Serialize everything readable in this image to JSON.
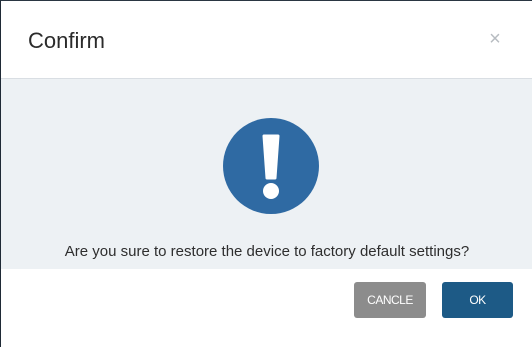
{
  "dialog": {
    "title": "Confirm",
    "close_glyph": "×",
    "icon": "exclamation-icon",
    "message": "Are you sure to restore the device to factory default settings?",
    "buttons": {
      "cancel_label": "CANCLE",
      "ok_label": "OK"
    }
  },
  "colors": {
    "icon_fill": "#2f6aa3",
    "ok_button": "#1d5a86",
    "cancel_button": "#8c8c8c",
    "body_background": "#edf1f4"
  }
}
